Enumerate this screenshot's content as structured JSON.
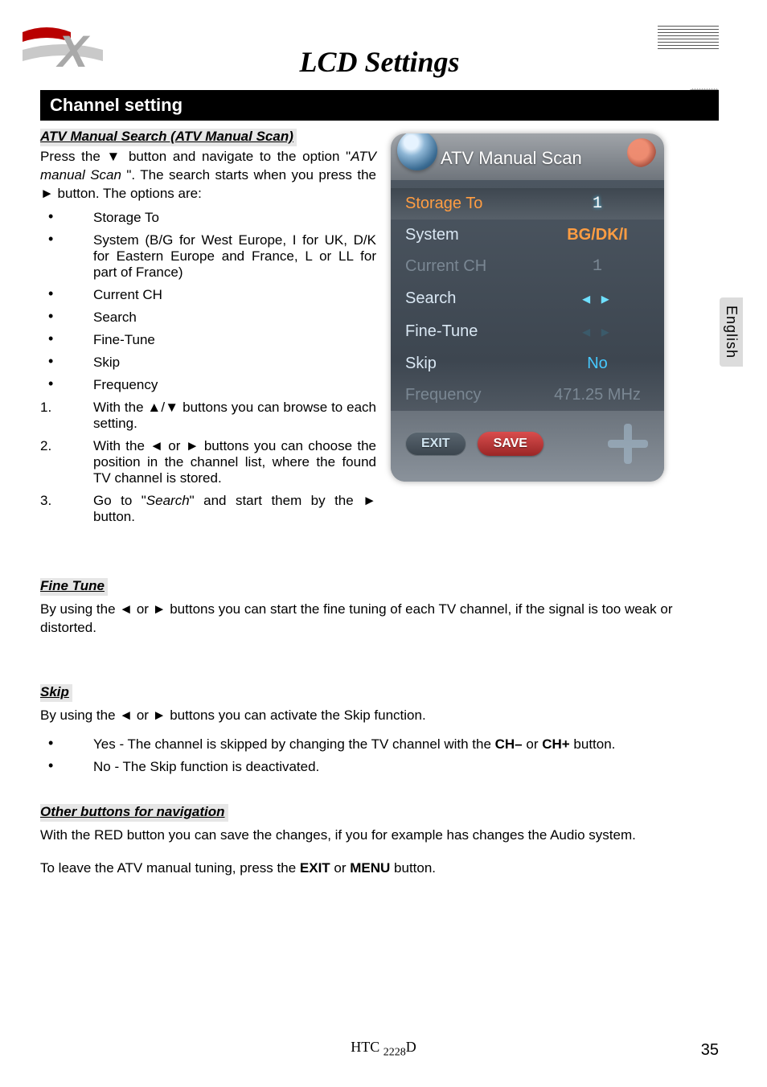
{
  "header": {
    "title": "LCD Settings",
    "section_bar": "Channel setting",
    "language_tab": "English"
  },
  "atv": {
    "heading": "ATV Manual Search (ATV Manual Scan)",
    "intro_1": "Press the ▼ button and navigate to the option \"",
    "intro_em": "ATV manual Scan",
    "intro_2": " \". The search starts when you press the ► button. The options are:",
    "options": [
      "Storage To",
      "System (B/G for West Europe, I for UK, D/K for Eastern Europe and France, L or LL for part of France)",
      "Current CH",
      "Search",
      "Fine-Tune",
      "Skip",
      "Frequency"
    ],
    "steps": [
      {
        "num": "1.",
        "text": "With the ▲/▼ buttons you can browse to each setting."
      },
      {
        "num": "2.",
        "text": "With the ◄ or ► buttons you can choose the position in the channel list, where the found TV channel is stored."
      },
      {
        "num": "3.",
        "text_a": "Go to \"",
        "text_em": "Search",
        "text_b": "\" and start them by the ► button."
      }
    ]
  },
  "osd": {
    "title": "ATV Manual Scan",
    "rows": {
      "storage_to": {
        "label": "Storage To",
        "value": "1"
      },
      "system": {
        "label": "System",
        "value": "BG/DK/I"
      },
      "current_ch": {
        "label": "Current CH",
        "value": "1"
      },
      "search": {
        "label": "Search",
        "value": "◂  ▸"
      },
      "fine_tune": {
        "label": "Fine-Tune",
        "value": "◂  ▸"
      },
      "skip": {
        "label": "Skip",
        "value": "No"
      },
      "frequency": {
        "label": "Frequency",
        "value": "471.25 MHz"
      }
    },
    "buttons": {
      "exit": "EXIT",
      "save": "SAVE"
    }
  },
  "fine_tune": {
    "heading": "Fine Tune",
    "text": "By using the ◄ or ► buttons you can start the fine tuning of each TV channel, if the signal is too weak or distorted."
  },
  "skip": {
    "heading": "Skip",
    "text": "By using the ◄ or ► buttons you can activate the Skip function.",
    "items": [
      {
        "pre": "Yes - The channel is skipped by changing the TV channel with the ",
        "b1": "CH–",
        "mid": " or ",
        "b2": "CH+",
        "post": " button."
      },
      {
        "pre": "No - The Skip function is deactivated."
      }
    ]
  },
  "other": {
    "heading": "Other buttons for navigation",
    "p1": "With the RED button you can save the changes, if you for example has changes the Audio system.",
    "p2_a": "To leave the ATV manual tuning, press the ",
    "p2_b1": "EXIT",
    "p2_mid": " or ",
    "p2_b2": "MENU",
    "p2_c": " button."
  },
  "footer": {
    "model_a": "HTC ",
    "model_b": "2228",
    "model_c": "D",
    "page": "35"
  }
}
